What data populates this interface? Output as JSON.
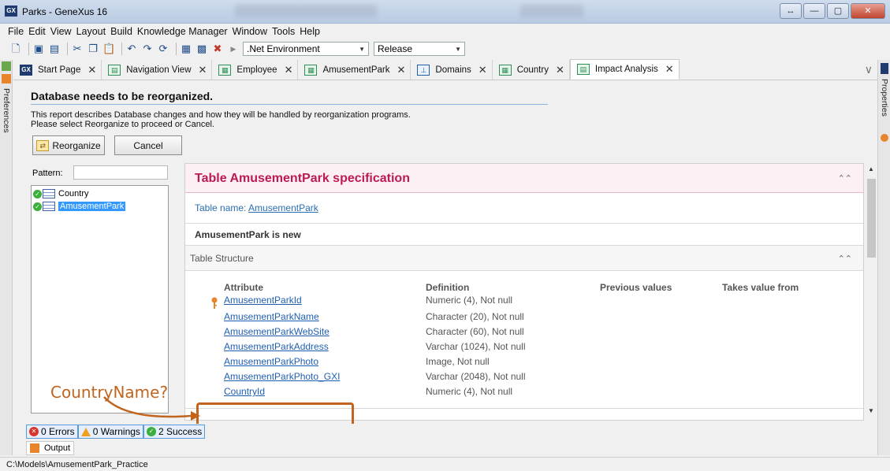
{
  "window": {
    "title": "Parks - GeneXus 16",
    "app_icon": "gx-logo"
  },
  "menu": [
    "File",
    "Edit",
    "View",
    "Layout",
    "Build",
    "Knowledge Manager",
    "Window",
    "Tools",
    "Help"
  ],
  "toolbar": {
    "environment": ".Net Environment",
    "configuration": "Release"
  },
  "side": {
    "left_label": "Preferences",
    "right_label": "Properties"
  },
  "tabs": [
    {
      "label": "Start Page",
      "icon": "gx-icon"
    },
    {
      "label": "Navigation View",
      "icon": "view-icon"
    },
    {
      "label": "Employee",
      "icon": "table-icon"
    },
    {
      "label": "AmusementPark",
      "icon": "table-icon"
    },
    {
      "label": "Domains",
      "icon": "domain-icon"
    },
    {
      "label": "Country",
      "icon": "table-icon"
    },
    {
      "label": "Impact Analysis",
      "icon": "report-icon",
      "active": true
    }
  ],
  "header": {
    "title": "Database needs to be reorganized.",
    "desc1": "This report describes Database changes and how they will be handled by reorganization programs.",
    "desc2": "Please select Reorganize to proceed or Cancel.",
    "reorganize": "Reorganize",
    "cancel": "Cancel"
  },
  "tree": {
    "pattern_label": "Pattern:",
    "items": [
      "Country",
      "AmusementPark"
    ]
  },
  "report": {
    "title": "Table AmusementPark specification",
    "table_name_label": "Table name:",
    "table_name": "AmusementPark",
    "status": "AmusementPark is new",
    "section": "Table Structure",
    "columns": [
      "Attribute",
      "Definition",
      "Previous values",
      "Takes value from"
    ],
    "rows": [
      {
        "attr": "AmusementParkId",
        "def": "Numeric (4), Not null",
        "key": true
      },
      {
        "attr": "AmusementParkName",
        "def": "Character (20), Not null"
      },
      {
        "attr": "AmusementParkWebSite",
        "def": "Character (60), Not null"
      },
      {
        "attr": "AmusementParkAddress",
        "def": "Varchar (1024), Not null"
      },
      {
        "attr": "AmusementParkPhoto",
        "def": "Image, Not null"
      },
      {
        "attr": "AmusementParkPhoto_GXI",
        "def": "Varchar (2048), Not null"
      },
      {
        "attr": "CountryId",
        "def": "Numeric (4), Not null"
      }
    ]
  },
  "annotation": {
    "text": "CountryName?",
    "color": "#c0641e"
  },
  "status": {
    "errors": "0 Errors",
    "warnings": "0 Warnings",
    "success": "2 Success"
  },
  "output_tab": "Output",
  "path": "C:\\Models\\AmusementPark_Practice"
}
